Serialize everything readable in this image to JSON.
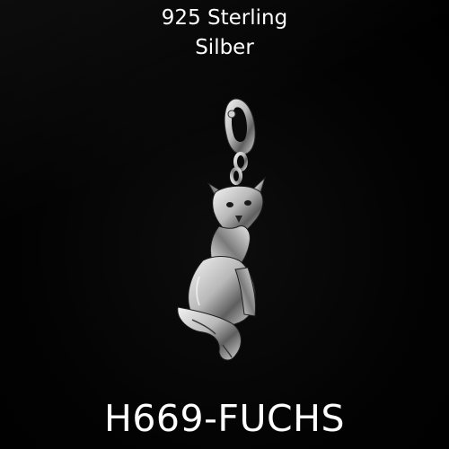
{
  "caption": {
    "line1": "925 Sterling",
    "line2": "Silber"
  },
  "product_code": "H669-FUCHS"
}
